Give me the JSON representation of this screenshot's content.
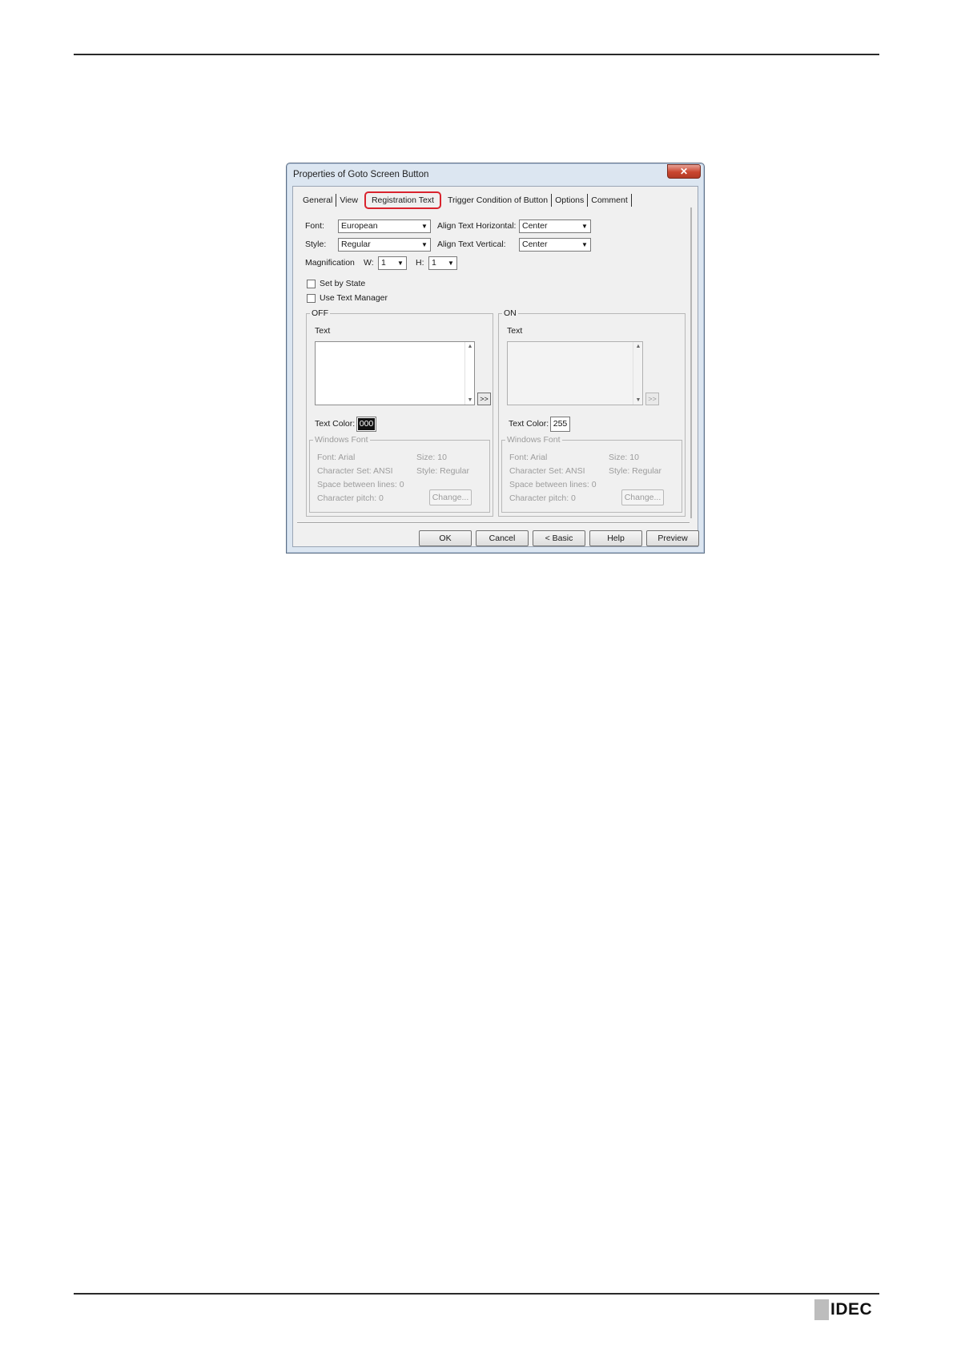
{
  "page": {
    "logo_text": "IDEC"
  },
  "dialog": {
    "title": "Properties of Goto Screen Button",
    "close_glyph": "✕",
    "tabs": [
      {
        "label": "General"
      },
      {
        "label": "View"
      },
      {
        "label": "Registration Text",
        "active": true
      },
      {
        "label": "Trigger Condition of Button"
      },
      {
        "label": "Options"
      },
      {
        "label": "Comment"
      }
    ],
    "highlight_color": "#d9232d",
    "font": {
      "label": "Font:",
      "value": "European"
    },
    "style": {
      "label": "Style:",
      "value": "Regular"
    },
    "align_h": {
      "label": "Align Text Horizontal:",
      "value": "Center"
    },
    "align_v": {
      "label": "Align Text Vertical:",
      "value": "Center"
    },
    "magnification": {
      "label": "Magnification",
      "w_label": "W:",
      "w_value": "1",
      "h_label": "H:",
      "h_value": "1"
    },
    "set_by_state": {
      "label": "Set by State",
      "checked": false
    },
    "use_text_manager": {
      "label": "Use Text Manager",
      "checked": false
    },
    "off": {
      "legend": "OFF",
      "text_label": "Text",
      "more_button": ">>",
      "text_color_label": "Text Color:",
      "text_color_value": "000",
      "windows_font": {
        "legend": "Windows Font",
        "font": "Font:   Arial",
        "size": "Size:   10",
        "charset": "Character Set:   ANSI",
        "style": "Style:   Regular",
        "spacing": "Space between lines:   0",
        "pitch": "Character pitch:   0",
        "change": "Change..."
      }
    },
    "on": {
      "legend": "ON",
      "text_label": "Text",
      "more_button": ">>",
      "text_color_label": "Text Color:",
      "text_color_value": "255",
      "windows_font": {
        "legend": "Windows Font",
        "font": "Font:   Arial",
        "size": "Size:   10",
        "charset": "Character Set:   ANSI",
        "style": "Style:   Regular",
        "spacing": "Space between lines:   0",
        "pitch": "Character pitch:   0",
        "change": "Change..."
      }
    },
    "buttons": {
      "ok": "OK",
      "cancel": "Cancel",
      "basic": "< Basic",
      "help": "Help",
      "preview": "Preview"
    }
  }
}
